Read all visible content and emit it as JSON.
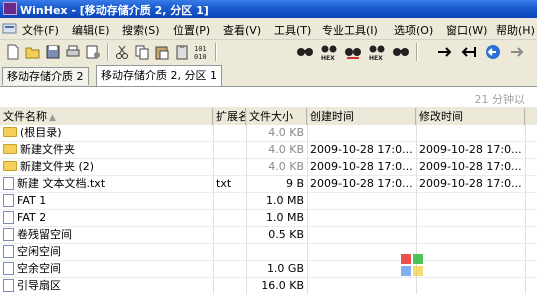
{
  "window": {
    "title": "WinHex - [移动存储介质 2, 分区 1]"
  },
  "menu": {
    "items": [
      "文件(F)",
      "编辑(E)",
      "搜索(S)",
      "位置(P)",
      "查看(V)",
      "工具(T)",
      "专业工具(I)",
      "选项(O)",
      "窗口(W)",
      "帮助(H)"
    ]
  },
  "toolbar": {
    "icons": [
      "new-icon",
      "open-icon",
      "save-icon",
      "print-icon",
      "properties-icon",
      "cut-icon",
      "copy-icon",
      "paste-icon",
      "clipboard-icon",
      "binary-icon",
      "find-text-icon",
      "find-hex-icon",
      "replace-text-icon",
      "replace-hex-icon",
      "find-next-icon",
      "goto-offset-icon",
      "goto-start-icon",
      "back-icon",
      "forward-icon"
    ]
  },
  "tabs": [
    {
      "label": "移动存储介质 2",
      "active": false
    },
    {
      "label": "移动存储介质 2, 分区 1",
      "active": true
    }
  ],
  "status": {
    "last_refresh": "21 分钟以"
  },
  "table": {
    "headers": {
      "name": "文件名称",
      "ext": "扩展名",
      "size": "文件大小",
      "created": "创建时间",
      "modified": "修改时间"
    },
    "rows": [
      {
        "icon": "folder-icon",
        "name": "(根目录)",
        "ext": "",
        "size": "4.0 KB",
        "size_gray": true,
        "created": "",
        "modified": ""
      },
      {
        "icon": "folder-icon",
        "name": "新建文件夹",
        "ext": "",
        "size": "4.0 KB",
        "size_gray": true,
        "created": "2009-10-28  17:0...",
        "modified": "2009-10-28  17:0..."
      },
      {
        "icon": "folder-icon",
        "name": "新建文件夹 (2)",
        "ext": "",
        "size": "4.0 KB",
        "size_gray": true,
        "created": "2009-10-28  17:0...",
        "modified": "2009-10-28  17:0..."
      },
      {
        "icon": "file-icon",
        "name": "新建 文本文档.txt",
        "ext": "txt",
        "size": "9 B",
        "size_gray": false,
        "created": "2009-10-28  17:0...",
        "modified": "2009-10-28  17:0..."
      },
      {
        "icon": "file-icon",
        "name": "FAT 1",
        "ext": "",
        "size": "1.0 MB",
        "size_gray": false,
        "created": "",
        "modified": ""
      },
      {
        "icon": "file-icon",
        "name": "FAT 2",
        "ext": "",
        "size": "1.0 MB",
        "size_gray": false,
        "created": "",
        "modified": ""
      },
      {
        "icon": "file-icon",
        "name": "卷残留空间",
        "ext": "",
        "size": "0.5 KB",
        "size_gray": false,
        "created": "",
        "modified": ""
      },
      {
        "icon": "file-icon",
        "name": "空闲空间",
        "ext": "",
        "size": "",
        "size_gray": false,
        "created": "",
        "modified": ""
      },
      {
        "icon": "file-icon",
        "name": "空余空间",
        "ext": "",
        "size": "1.0 GB",
        "size_gray": false,
        "created": "",
        "modified": ""
      },
      {
        "icon": "file-icon",
        "name": "引导扇区",
        "ext": "",
        "size": "16.0 KB",
        "size_gray": false,
        "created": "",
        "modified": ""
      }
    ]
  },
  "colors": {
    "title_bar": "#1d5dd0",
    "window_bg": "#ece9d8",
    "folder": "#f4cf5a"
  }
}
